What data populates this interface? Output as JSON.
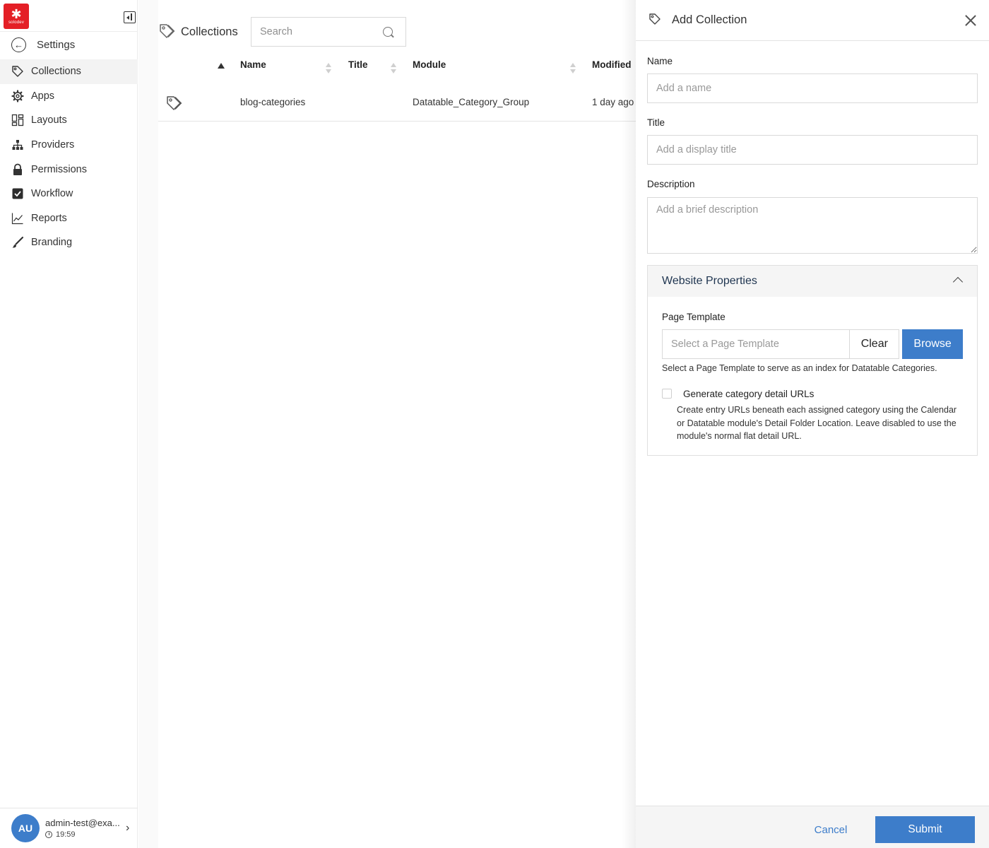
{
  "app": {
    "logo_text": "solodev"
  },
  "sidebar": {
    "back_label": "Settings",
    "items": [
      {
        "label": "Collections",
        "icon": "tag-icon",
        "active": true
      },
      {
        "label": "Apps",
        "icon": "gear-icon",
        "active": false
      },
      {
        "label": "Layouts",
        "icon": "layout-icon",
        "active": false
      },
      {
        "label": "Providers",
        "icon": "sitemap-icon",
        "active": false
      },
      {
        "label": "Permissions",
        "icon": "lock-icon",
        "active": false
      },
      {
        "label": "Workflow",
        "icon": "check-square-icon",
        "active": false
      },
      {
        "label": "Reports",
        "icon": "line-chart-icon",
        "active": false
      },
      {
        "label": "Branding",
        "icon": "brush-icon",
        "active": false
      }
    ],
    "user": {
      "initials": "AU",
      "email": "admin-test@exa...",
      "time": "19:59"
    }
  },
  "main": {
    "title": "Collections",
    "search": {
      "placeholder": "Search",
      "value": ""
    },
    "columns": [
      "Name",
      "Title",
      "Module",
      "Modified"
    ],
    "rows": [
      {
        "name": "blog-categories",
        "title": "",
        "module": "Datatable_Category_Group",
        "modified": "1 day ago"
      }
    ]
  },
  "drawer": {
    "title": "Add Collection",
    "name": {
      "label": "Name",
      "placeholder": "Add a name",
      "value": ""
    },
    "display_title": {
      "label": "Title",
      "placeholder": "Add a display title",
      "value": ""
    },
    "description": {
      "label": "Description",
      "placeholder": "Add a brief description",
      "value": ""
    },
    "website_properties": {
      "title": "Website Properties",
      "expanded": true,
      "page_template": {
        "label": "Page Template",
        "placeholder": "Select a Page Template",
        "value": "",
        "clear_label": "Clear",
        "browse_label": "Browse",
        "help": "Select a Page Template to serve as an index for Datatable Categories."
      },
      "detail_urls": {
        "label": "Generate category detail URLs",
        "checked": false,
        "help": "Create entry URLs beneath each assigned category using the Calendar or Datatable module's Detail Folder Location. Leave disabled to use the module's normal flat detail URL."
      }
    },
    "cancel_label": "Cancel",
    "submit_label": "Submit"
  },
  "colors": {
    "accent": "#3d7dca",
    "brand": "#e41f26",
    "panel_title": "#1f3550"
  }
}
